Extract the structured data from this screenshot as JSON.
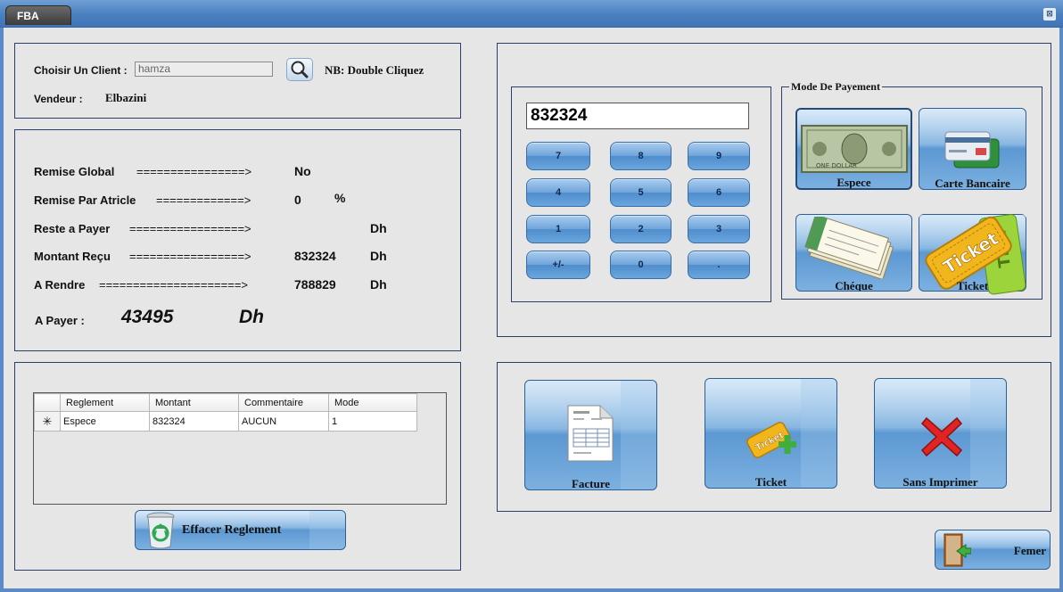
{
  "window": {
    "title": "FBA",
    "close_glyph": "⊠"
  },
  "client": {
    "choose_label": "Choisir Un Client :",
    "client_value": "hamza",
    "hint": "NB: Double Cliquez",
    "vendor_label": "Vendeur :",
    "vendor_value": "Elbazini"
  },
  "summary": {
    "remise_global_label": "Remise Global",
    "remise_global_arrow": "================>",
    "remise_global_value": "No",
    "remise_article_label": "Remise Par Atricle",
    "remise_article_arrow": "=============>",
    "remise_article_value": "0",
    "remise_article_unit": "%",
    "reste_label": "Reste a Payer",
    "reste_arrow": "=================>",
    "reste_value": "",
    "reste_unit": "Dh",
    "montant_label": "Montant Reçu",
    "montant_arrow": "=================>",
    "montant_value": "832324",
    "montant_unit": "Dh",
    "rendre_label": "A Rendre",
    "rendre_arrow": "=====================>",
    "rendre_value": "788829",
    "rendre_unit": "Dh",
    "payer_label": "A Payer :",
    "payer_value": "43495",
    "payer_unit": "Dh"
  },
  "grid": {
    "columns": [
      "Reglement",
      "Montant",
      "Commentaire",
      "Mode"
    ],
    "rows": [
      {
        "marker": "✳",
        "reglement": "Espece",
        "montant": "832324",
        "commentaire": "AUCUN",
        "mode": "1"
      }
    ]
  },
  "delete_button": {
    "label": "Effacer Reglement",
    "icon": "recycle-bin-icon"
  },
  "calculator": {
    "display": "832324",
    "keys": [
      "7",
      "8",
      "9",
      "4",
      "5",
      "6",
      "1",
      "2",
      "3",
      "+/-",
      "0",
      "."
    ]
  },
  "payment": {
    "legend": "Mode De Payement",
    "espece": "Espece",
    "carte": "Carte Bancaire",
    "cheque": "Chéque",
    "ticket": "Ticket"
  },
  "print": {
    "facture": "Facture",
    "ticket": "Ticket",
    "sans": "Sans Imprimer"
  },
  "close_button": {
    "label": "Femer",
    "icon": "exit-door-icon"
  },
  "colors": {
    "accent": "#5c98d2",
    "frame": "#4a7fc0",
    "panel_border": "#2b3f6a"
  }
}
